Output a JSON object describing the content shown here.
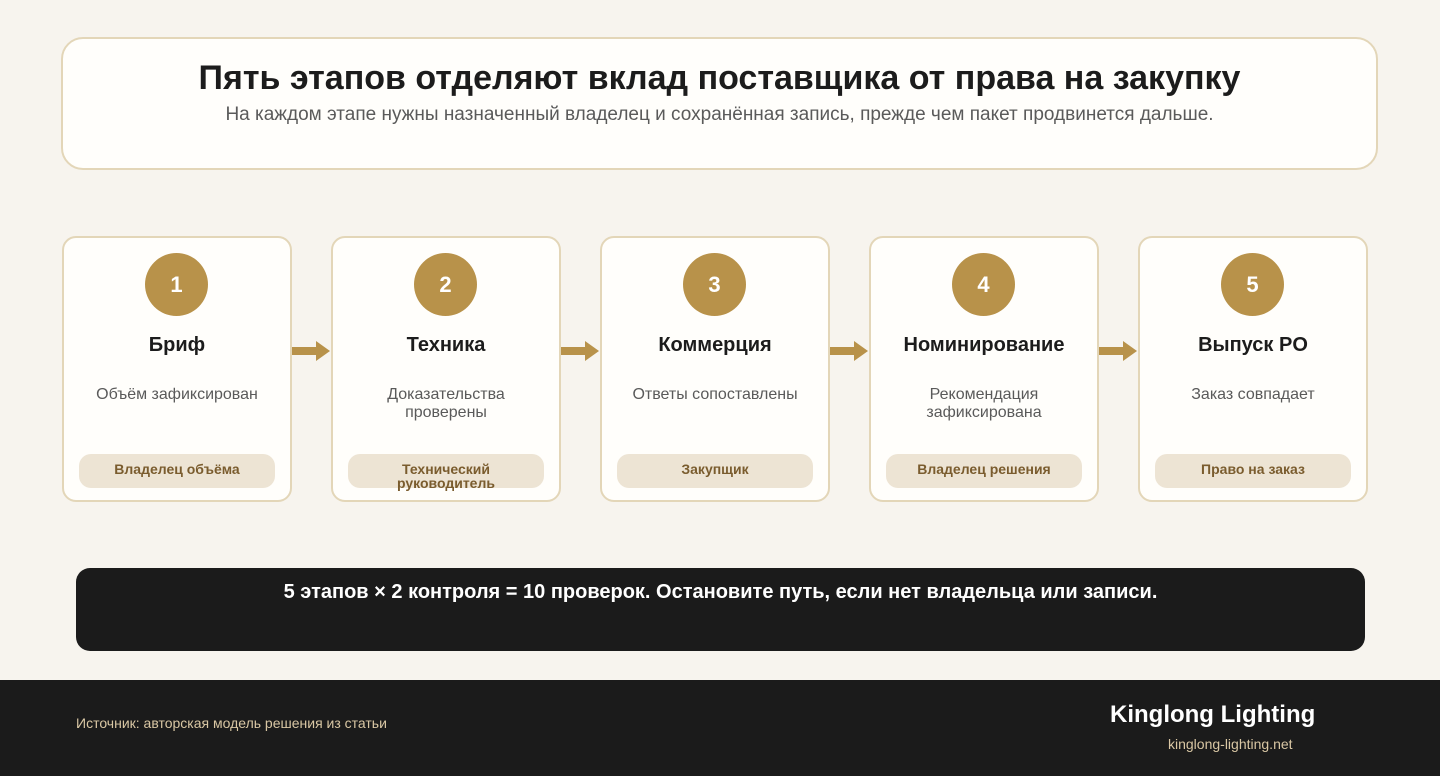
{
  "header": {
    "title": "Пять этапов отделяют вклад поставщика от права на закупку",
    "subtitle": "На каждом этапе нужны назначенный владелец и сохранённая запись, прежде чем пакет продвинется дальше."
  },
  "stages": [
    {
      "number": "1",
      "title": "Бриф",
      "text": "Объём зафиксирован",
      "owner": "Владелец объёма"
    },
    {
      "number": "2",
      "title": "Техника",
      "text": "Доказательства проверены",
      "owner": "Технический руководитель"
    },
    {
      "number": "3",
      "title": "Коммерция",
      "text": "Ответы сопоставлены",
      "owner": "Закупщик"
    },
    {
      "number": "4",
      "title": "Номинирование",
      "text": "Рекомендация зафиксирована",
      "owner": "Владелец решения"
    },
    {
      "number": "5",
      "title": "Выпуск PO",
      "text": "Заказ совпадает",
      "owner": "Право на заказ"
    }
  ],
  "summary": "5 этапов × 2 контроля = 10 проверок. Остановите путь, если нет владельца или записи.",
  "footer": {
    "source": "Источник: авторская модель решения из статьи",
    "brand_name": "Kinglong Lighting",
    "brand_url": "kinglong-lighting.net"
  },
  "colors": {
    "accent": "#b8924a",
    "card_border": "#e3d6b8",
    "owner_bg": "#ede4d4",
    "dark": "#1b1b1b",
    "background": "#f7f4ee"
  },
  "icons": {
    "connector": "arrow-right-icon"
  }
}
